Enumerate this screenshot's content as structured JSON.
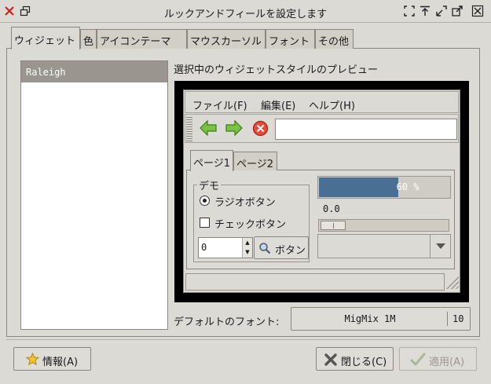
{
  "window": {
    "title": "ルックアンドフィールを設定します"
  },
  "tabs": [
    {
      "label": "ウィジェット",
      "active": true
    },
    {
      "label": "色"
    },
    {
      "label": "アイコンテーマ"
    },
    {
      "label": "マウスカーソル"
    },
    {
      "label": "フォント"
    },
    {
      "label": "その他"
    }
  ],
  "theme_list": {
    "items": [
      "Raleigh"
    ],
    "selected": "Raleigh"
  },
  "preview": {
    "label": "選択中のウィジェットスタイルのプレビュー",
    "menus": [
      "ファイル(F)",
      "編集(E)",
      "ヘルプ(H)"
    ],
    "toolbar_entry": "",
    "pages": [
      "ページ1",
      "ページ2"
    ],
    "group_title": "デモ",
    "radio_label": "ラジオボタン",
    "check_label": "チェックボタン",
    "spin_value": "0",
    "button_label": "ボタン",
    "progress": {
      "value": 60,
      "text": "60 %"
    },
    "scale": {
      "value": "0.0",
      "fraction": 0.0
    }
  },
  "font": {
    "label": "デフォルトのフォント:",
    "name": "MigMix 1M",
    "size": "10"
  },
  "buttons": {
    "info": "情報(A)",
    "close": "閉じる(C)",
    "apply": "適用(A)"
  },
  "colors": {
    "selection": "#9a968f",
    "progress_fill": "#4a6f94",
    "close_red": "#cc2222"
  }
}
